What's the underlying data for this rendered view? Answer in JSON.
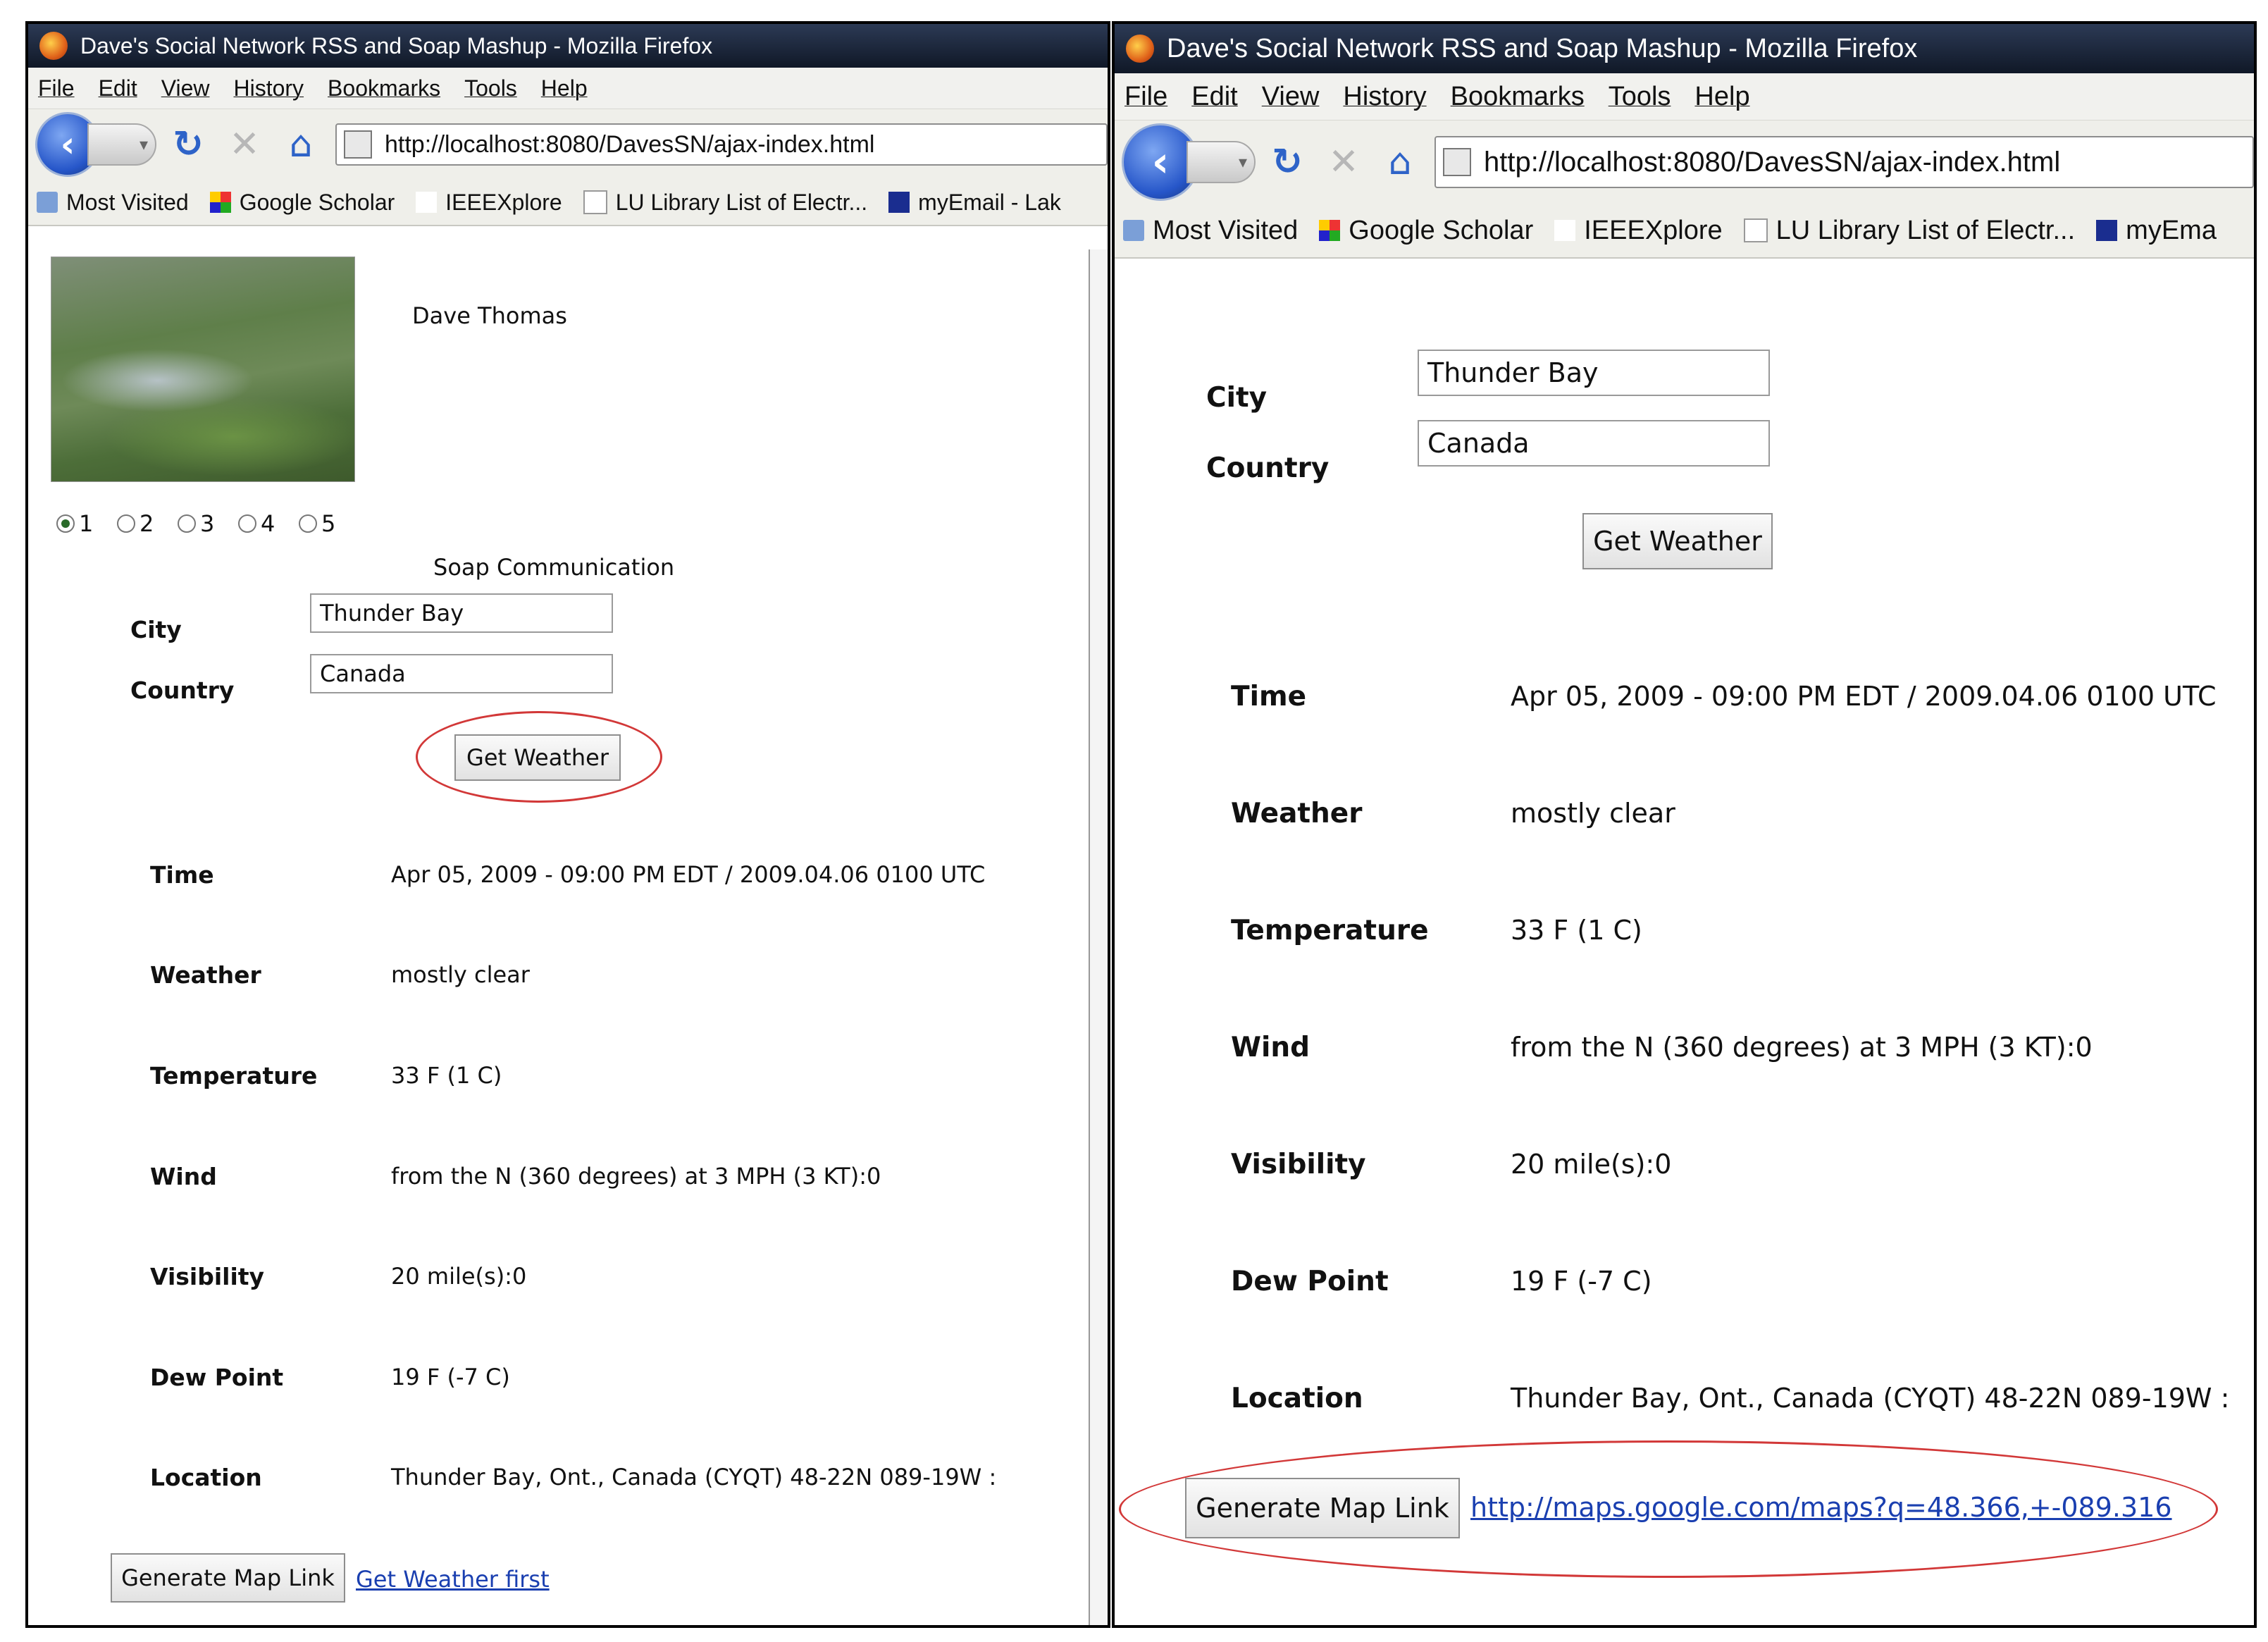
{
  "browser": {
    "title": "Dave's Social Network RSS and Soap Mashup - Mozilla Firefox",
    "menu": [
      "File",
      "Edit",
      "View",
      "History",
      "Bookmarks",
      "Tools",
      "Help"
    ],
    "url": "http://localhost:8080/DavesSN/ajax-index.html",
    "bookmarks_left": [
      "Most Visited",
      "Google Scholar",
      "IEEEXplore",
      "LU Library List of Electr...",
      "myEmail - Lak"
    ],
    "bookmarks_right": [
      "Most Visited",
      "Google Scholar",
      "IEEEXplore",
      "LU Library List of Electr...",
      "myEma"
    ]
  },
  "profile": {
    "name": "Dave Thomas",
    "radio_options": [
      "1",
      "2",
      "3",
      "4",
      "5"
    ],
    "selected": "1"
  },
  "soap": {
    "section_title": "Soap Communication",
    "city_label": "City",
    "city_value": "Thunder Bay",
    "country_label": "Country",
    "country_value": "Canada",
    "get_weather_label": "Get Weather"
  },
  "weather": {
    "rows": [
      {
        "label": "Time",
        "value": "Apr 05, 2009 - 09:00 PM EDT / 2009.04.06 0100 UTC"
      },
      {
        "label": "Weather",
        "value": "mostly clear"
      },
      {
        "label": "Temperature",
        "value": "33 F (1 C)"
      },
      {
        "label": "Wind",
        "value": "from the N (360 degrees) at 3 MPH (3 KT):0"
      },
      {
        "label": "Visibility",
        "value": "20 mile(s):0"
      },
      {
        "label": "Dew Point",
        "value": "19 F (-7 C)"
      },
      {
        "label": "Location",
        "value": "Thunder Bay, Ont., Canada (CYQT) 48-22N 089-19W :"
      }
    ]
  },
  "map": {
    "button_label": "Generate Map Link",
    "left_link": "Get Weather first",
    "right_link": "http://maps.google.com/maps?q=48.366,+-089.316"
  },
  "colors": {
    "annotation": "#d23838",
    "link": "#1a3fb0"
  }
}
